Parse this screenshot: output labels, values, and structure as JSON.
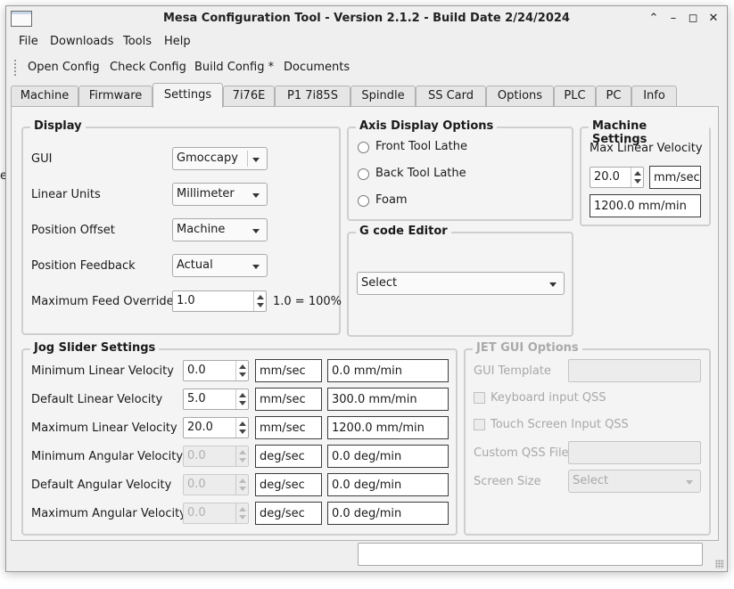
{
  "window": {
    "title": "Mesa Configuration Tool - Version 2.1.2 - Build Date 2/24/2024"
  },
  "edge_text": "e",
  "menu": [
    "File",
    "Downloads",
    "Tools",
    "Help"
  ],
  "toolbar": [
    "Open Config",
    "Check Config",
    "Build Config *",
    "Documents"
  ],
  "tabs": [
    "Machine",
    "Firmware",
    "Settings",
    "7i76E",
    "P1 7i85S",
    "Spindle",
    "SS Card",
    "Options",
    "PLC",
    "PC",
    "Info"
  ],
  "active_tab": "Settings",
  "display": {
    "title": "Display",
    "gui": {
      "label": "GUI",
      "value": "Gmoccapy"
    },
    "linear_units": {
      "label": "Linear Units",
      "value": "Millimeter"
    },
    "position_offset": {
      "label": "Position Offset",
      "value": "Machine"
    },
    "position_feedback": {
      "label": "Position Feedback",
      "value": "Actual"
    },
    "max_feed_override": {
      "label": "Maximum Feed Override",
      "value": "1.0",
      "note": "1.0 = 100%"
    }
  },
  "axis_display": {
    "title": "Axis Display Options",
    "options": [
      "Front Tool Lathe",
      "Back Tool Lathe",
      "Foam"
    ]
  },
  "gcode_editor": {
    "title": "G code Editor",
    "value": "Select"
  },
  "machine_settings": {
    "title": "Machine Settings",
    "label": "Max Linear Velocity",
    "value": "20.0",
    "unit": "mm/sec",
    "converted": "1200.0 mm/min"
  },
  "jog": {
    "title": "Jog Slider Settings",
    "rows": [
      {
        "label": "Minimum Linear Velocity",
        "value": "0.0",
        "unit": "mm/sec",
        "converted": "0.0 mm/min"
      },
      {
        "label": "Default Linear Velocity",
        "value": "5.0",
        "unit": "mm/sec",
        "converted": "300.0 mm/min"
      },
      {
        "label": "Maximum Linear Velocity",
        "value": "20.0",
        "unit": "mm/sec",
        "converted": "1200.0 mm/min"
      },
      {
        "label": "Minimum Angular Velocity",
        "value": "0.0",
        "unit": "deg/sec",
        "converted": "0.0 deg/min"
      },
      {
        "label": "Default Angular Velocity",
        "value": "0.0",
        "unit": "deg/sec",
        "converted": "0.0 deg/min"
      },
      {
        "label": "Maximum Angular Velocity",
        "value": "0.0",
        "unit": "deg/sec",
        "converted": "0.0 deg/min"
      }
    ]
  },
  "jet": {
    "title": "JET GUI Options",
    "gui_template": "GUI Template",
    "keyboard_qss": "Keyboard input QSS",
    "touch_qss": "Touch Screen Input QSS",
    "custom_qss": "Custom QSS File",
    "screen_size": {
      "label": "Screen Size",
      "value": "Select"
    }
  }
}
